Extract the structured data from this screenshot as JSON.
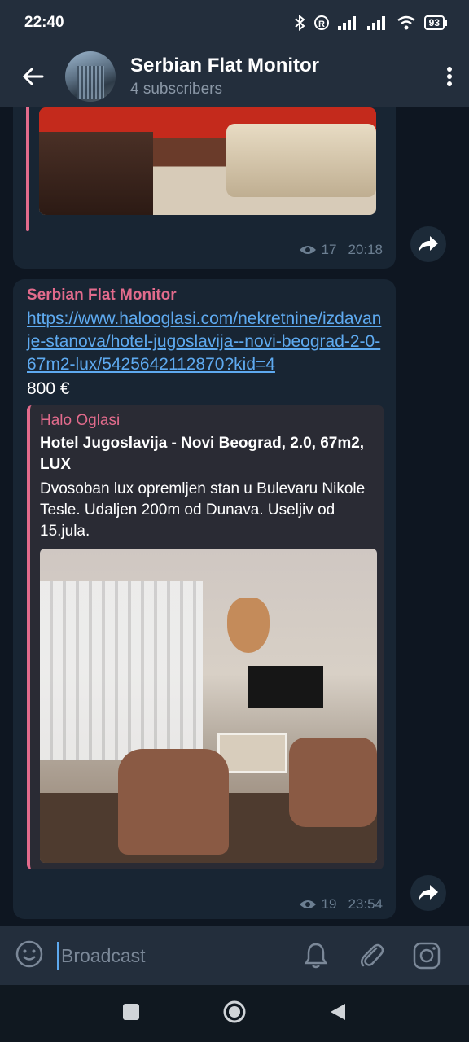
{
  "status_bar": {
    "time": "22:40",
    "battery": "93"
  },
  "header": {
    "title": "Serbian Flat Monitor",
    "subtitle": "4 subscribers"
  },
  "messages": [
    {
      "views": "17",
      "time": "20:18"
    },
    {
      "sender": "Serbian Flat Monitor",
      "link": "https://www.halooglasi.com/nekretnine/izdavanje-stanova/hotel-jugoslavija--novi-beograd-2-0-67m2-lux/5425642112870?kid=4",
      "price": "800 €",
      "preview": {
        "site": "Halo Oglasi",
        "title": "Hotel Jugoslavija - Novi Beograd, 2.0, 67m2, LUX",
        "description": "Dvosoban lux opremljen stan u Bulevaru Nikole Tesle. Udaljen 200m od Dunava. Useljiv od 15.jula."
      },
      "views": "19",
      "time": "23:54"
    }
  ],
  "input": {
    "placeholder": "Broadcast"
  }
}
